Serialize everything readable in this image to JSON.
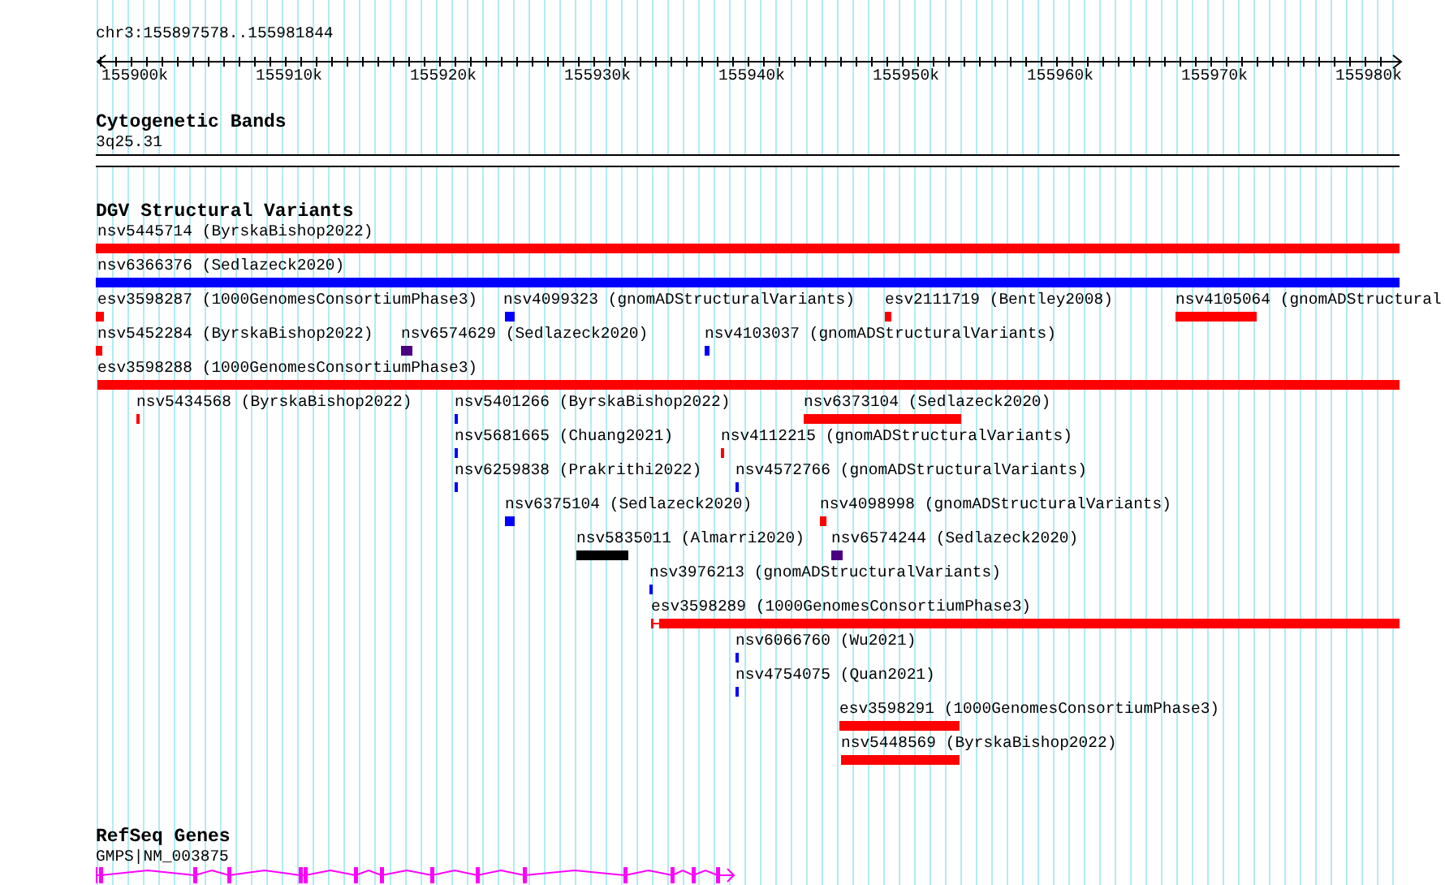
{
  "location": "chr3:155897578..155981844",
  "ruler": {
    "ticks": [
      "155900k",
      "155910k",
      "155920k",
      "155930k",
      "155940k",
      "155950k",
      "155960k",
      "155970k",
      "155980k"
    ]
  },
  "cytogenetic_bands": {
    "title": "Cytogenetic Bands",
    "band": "3q25.31"
  },
  "dgv": {
    "title": "DGV Structural Variants",
    "rows": [
      {
        "features": [
          {
            "label": "nsv5445714 (ByrskaBishop2022)",
            "color": "#ff0000"
          }
        ]
      },
      {
        "features": [
          {
            "label": "nsv6366376 (Sedlazeck2020)",
            "color": "#0000ff"
          }
        ]
      },
      {
        "features": [
          {
            "label": "esv3598287 (1000GenomesConsortiumPhase3)",
            "color": "#ff0000"
          },
          {
            "label": "nsv4099323 (gnomADStructuralVariants)",
            "color": "#0000ff"
          },
          {
            "label": "esv2111719 (Bentley2008)",
            "color": "#ff0000"
          },
          {
            "label": "nsv4105064 (gnomADStructural",
            "color": "#ff0000"
          }
        ]
      },
      {
        "features": [
          {
            "label": "nsv5452284 (ByrskaBishop2022)",
            "color": "#ff0000"
          },
          {
            "label": "nsv6574629 (Sedlazeck2020)",
            "color": "#4b0082"
          },
          {
            "label": "nsv4103037 (gnomADStructuralVariants)",
            "color": "#0000ff"
          }
        ]
      },
      {
        "features": [
          {
            "label": "esv3598288 (1000GenomesConsortiumPhase3)",
            "color": "#ff0000"
          }
        ]
      },
      {
        "features": [
          {
            "label": "nsv5434568 (ByrskaBishop2022)",
            "color": "#ff0000"
          },
          {
            "label": "nsv5401266 (ByrskaBishop2022)",
            "color": "#0000ff"
          },
          {
            "label": "nsv6373104 (Sedlazeck2020)",
            "color": "#ff0000"
          }
        ]
      },
      {
        "features": [
          {
            "label": "nsv5681665 (Chuang2021)",
            "color": "#0000ff"
          },
          {
            "label": "nsv4112215 (gnomADStructuralVariants)",
            "color": "#ff0000"
          }
        ]
      },
      {
        "features": [
          {
            "label": "nsv6259838 (Prakrithi2022)",
            "color": "#0000ff"
          },
          {
            "label": "nsv4572766 (gnomADStructuralVariants)",
            "color": "#0000ff"
          }
        ]
      },
      {
        "features": [
          {
            "label": "nsv6375104 (Sedlazeck2020)",
            "color": "#0000ff"
          },
          {
            "label": "nsv4098998 (gnomADStructuralVariants)",
            "color": "#ff0000"
          }
        ]
      },
      {
        "features": [
          {
            "label": "nsv5835011 (Almarri2020)",
            "color": "#000000"
          },
          {
            "label": "nsv6574244 (Sedlazeck2020)",
            "color": "#4b0082"
          }
        ]
      },
      {
        "features": [
          {
            "label": "nsv3976213 (gnomADStructuralVariants)",
            "color": "#0000ff"
          }
        ]
      },
      {
        "features": [
          {
            "label": "esv3598289 (1000GenomesConsortiumPhase3)",
            "color": "#ff0000"
          }
        ]
      },
      {
        "features": [
          {
            "label": "nsv6066760 (Wu2021)",
            "color": "#0000ff"
          }
        ]
      },
      {
        "features": [
          {
            "label": "nsv4754075 (Quan2021)",
            "color": "#0000ff"
          }
        ]
      },
      {
        "features": [
          {
            "label": "esv3598291 (1000GenomesConsortiumPhase3)",
            "color": "#ff0000"
          }
        ]
      },
      {
        "features": [
          {
            "label": "nsv5448569 (ByrskaBishop2022)",
            "color": "#ff0000"
          }
        ]
      }
    ]
  },
  "refseq_genes": {
    "title": "RefSeq Genes",
    "genes": [
      {
        "label": "GMPS|NM_003875"
      }
    ]
  }
}
